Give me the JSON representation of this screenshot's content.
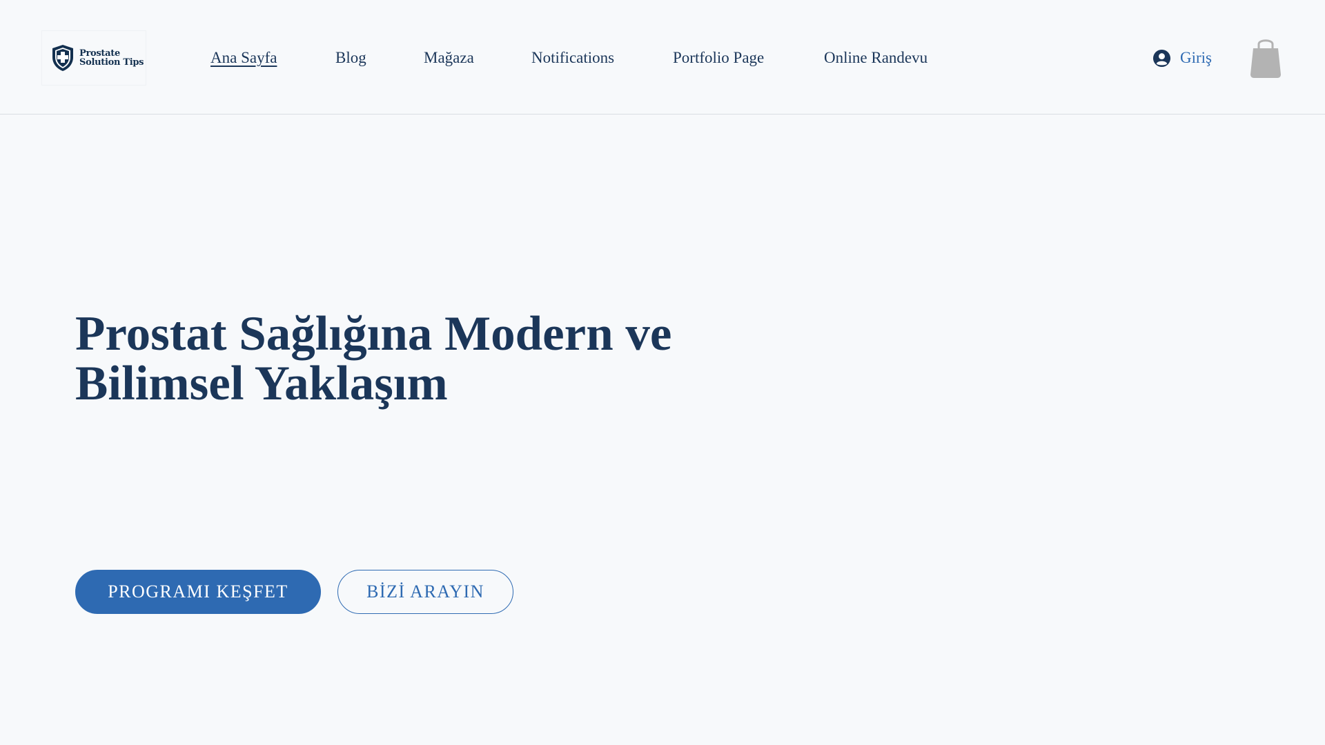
{
  "header": {
    "logo": {
      "line1": "Prostate",
      "line2": "Solution Tips"
    },
    "nav": [
      {
        "label": "Ana Sayfa",
        "active": true
      },
      {
        "label": "Blog",
        "active": false
      },
      {
        "label": "Mağaza",
        "active": false
      },
      {
        "label": "Notifications",
        "active": false
      },
      {
        "label": "Portfolio Page",
        "active": false
      },
      {
        "label": "Online Randevu",
        "active": false
      }
    ],
    "login_label": "Giriş",
    "cart_icon": "shopping-bag-icon",
    "user_icon": "user-avatar-icon"
  },
  "hero": {
    "title_line1": "Prostat Sağlığına Modern ve",
    "title_line2": "Bilimsel Yaklaşım",
    "primary_button": "PROGRAMI KEŞFET",
    "secondary_button": "BİZİ ARAYIN"
  },
  "colors": {
    "background": "#f7f9fb",
    "primary": "#2e6ab2",
    "heading": "#1b3659",
    "cart": "#b3b3b3"
  }
}
